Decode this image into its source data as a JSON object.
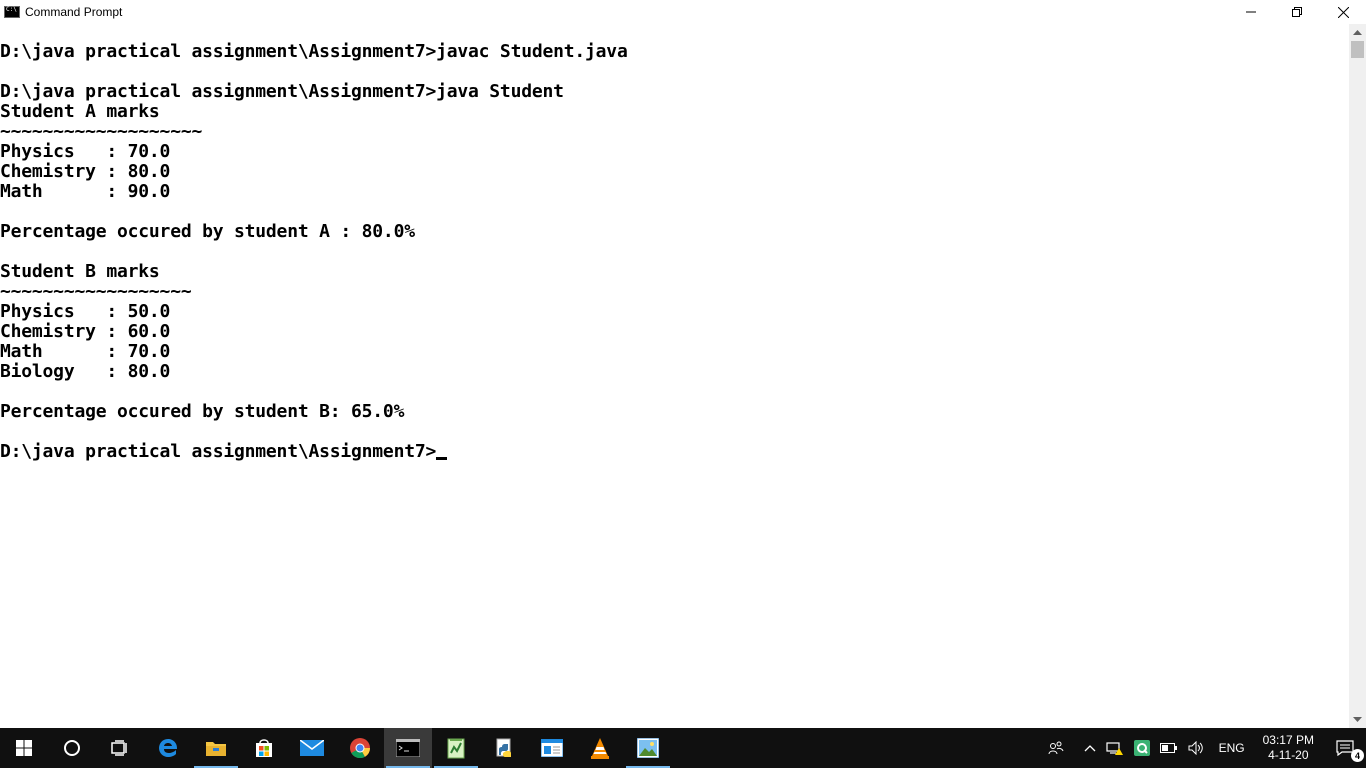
{
  "window": {
    "title": "Command Prompt"
  },
  "console": {
    "lines": [
      "",
      "D:\\java practical assignment\\Assignment7>javac Student.java",
      "",
      "D:\\java practical assignment\\Assignment7>java Student",
      "Student A marks",
      "~~~~~~~~~~~~~~~~~~~",
      "Physics   : 70.0",
      "Chemistry : 80.0",
      "Math      : 90.0",
      "",
      "Percentage occured by student A : 80.0%",
      "",
      "Student B marks",
      "~~~~~~~~~~~~~~~~~~",
      "Physics   : 50.0",
      "Chemistry : 60.0",
      "Math      : 70.0",
      "Biology   : 80.0",
      "",
      "Percentage occured by student B: 65.0%",
      "",
      "D:\\java practical assignment\\Assignment7>"
    ]
  },
  "taskbar": {
    "apps": [
      {
        "icon": "cortana-search-icon"
      },
      {
        "icon": "task-view-icon"
      },
      {
        "icon": "edge-browser-icon"
      },
      {
        "icon": "file-explorer-icon"
      },
      {
        "icon": "store-icon"
      },
      {
        "icon": "mail-icon"
      },
      {
        "icon": "chrome-icon"
      },
      {
        "icon": "command-prompt-icon"
      },
      {
        "icon": "notepad-plus-icon"
      },
      {
        "icon": "python-icon"
      },
      {
        "icon": "app-window-icon"
      },
      {
        "icon": "vlc-icon"
      },
      {
        "icon": "photos-icon"
      }
    ],
    "language": "ENG",
    "time": "03:17 PM",
    "date": "4-11-20",
    "notification_count": "4"
  },
  "colors": {
    "taskbar_bg": "#101010",
    "accent": "#76b9ed"
  }
}
